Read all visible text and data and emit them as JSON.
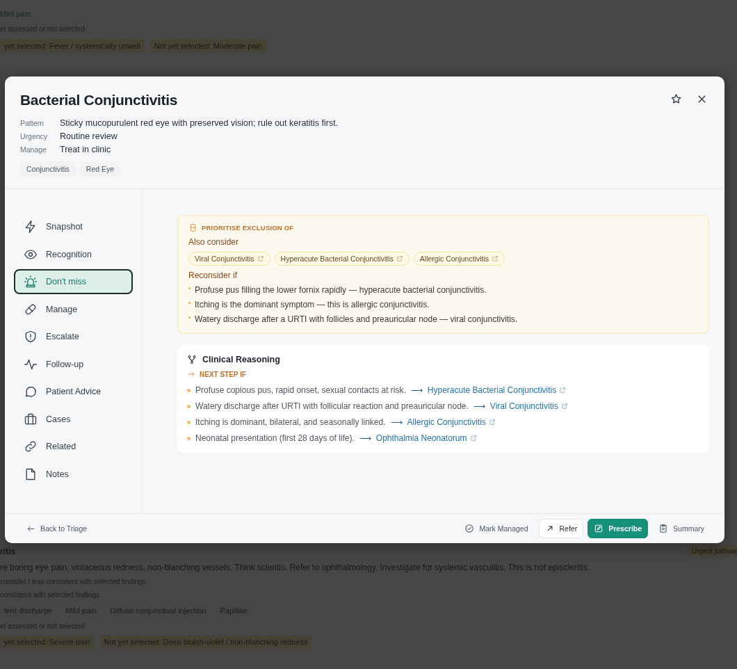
{
  "background_page": {
    "top": {
      "finding": "Mild pain",
      "status_note": "et assessed or not selected",
      "chips": [
        "yet selected: Fever / systemically unwell",
        "Not yet selected: Moderate pain"
      ]
    },
    "bottom": {
      "title": "ritis",
      "badge": "Urgent pathwa",
      "summary": "re boring eye pain, violaceous redness, non-blanching vessels. Think scleritis. Refer to ophthalmology. Investigate for systemic vasculitis. This is not episcleritis.",
      "notes": [
        "consider / less consistent with selected findings.",
        "consistent with selected findings."
      ],
      "findings": [
        "lent discharge",
        "Mild pain",
        "Diffuse conjunctival injection",
        "Papillae"
      ],
      "status_note": "et assessed or not selected",
      "chips": [
        "yet selected: Severe pain",
        "Not yet selected: Deep bluish-violet / non-blanching redness"
      ]
    }
  },
  "modal": {
    "title": "Bacterial Conjunctivitis",
    "starred": false,
    "meta": [
      {
        "label": "Pattern",
        "value": "Sticky mucopurulent red eye with preserved vision; rule out keratitis first."
      },
      {
        "label": "Urgency",
        "value": "Routine review"
      },
      {
        "label": "Manage",
        "value": "Treat in clinic"
      }
    ],
    "tags": [
      "Conjunctivitis",
      "Red Eye"
    ],
    "nav": [
      {
        "label": "Snapshot",
        "selected": false
      },
      {
        "label": "Recognition",
        "selected": false
      },
      {
        "label": "Don't miss",
        "selected": true
      },
      {
        "label": "Manage",
        "selected": false
      },
      {
        "label": "Escalate",
        "selected": false
      },
      {
        "label": "Follow-up",
        "selected": false
      },
      {
        "label": "Patient Advice",
        "selected": false
      },
      {
        "label": "Cases",
        "selected": false
      },
      {
        "label": "Related",
        "selected": false
      },
      {
        "label": "Notes",
        "selected": false
      }
    ],
    "exclusion": {
      "heading": "PRIORITISE EXCLUSION OF",
      "also_consider_label": "Also consider",
      "also_consider": [
        "Viral Conjunctivitis",
        "Hyperacute Bacterial Conjunctivitis",
        "Allergic Conjunctivitis"
      ],
      "reconsider_label": "Reconsider if",
      "reconsider": [
        "Profuse pus filling the lower fornix rapidly — hyperacute bacterial conjunctivitis.",
        "Itching is the dominant symptom — this is allergic conjunctivitis.",
        "Watery discharge after a URTI with follicles and preauricular node — viral conjunctivitis."
      ]
    },
    "reasoning": {
      "title": "Clinical Reasoning",
      "next_step_label": "NEXT STEP IF",
      "steps": [
        {
          "text": "Profuse copious pus, rapid onset, sexual contacts at risk.",
          "arrow": "⟶",
          "link": "Hyperacute Bacterial Conjunctivitis"
        },
        {
          "text": "Watery discharge after URTI with follicular reaction and preauricular node.",
          "arrow": "⟶",
          "link": "Viral Conjunctivitis"
        },
        {
          "text": "Itching is dominant, bilateral, and seasonally linked.",
          "arrow": "⟶",
          "link": "Allergic Conjunctivitis"
        },
        {
          "text": "Neonatal presentation (first 28 days of life).",
          "arrow": "⟶",
          "link": "Ophthalmia Neonatorum"
        }
      ]
    },
    "footer": {
      "back": "Back to Triage",
      "actions": [
        {
          "label": "Mark Managed",
          "kind": "plain"
        },
        {
          "label": "Refer",
          "kind": "outlined"
        },
        {
          "label": "Prescribe",
          "kind": "primary"
        },
        {
          "label": "Summary",
          "kind": "plain"
        }
      ]
    }
  }
}
